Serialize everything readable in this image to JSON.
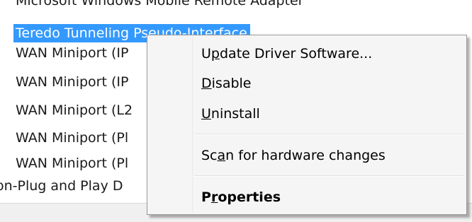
{
  "tree": {
    "rows": [
      {
        "label": "Microsoft Windows Mobile Remote Adapter"
      },
      {
        "label": "Teredo Tunneling Pseudo-Interface",
        "selected": true
      },
      {
        "label": "WAN Miniport (IP"
      },
      {
        "label": "WAN Miniport (IP"
      },
      {
        "label": "WAN Miniport (L2"
      },
      {
        "label": "WAN Miniport (Pl"
      },
      {
        "label": "WAN Miniport (Pl"
      },
      {
        "label": "on-Plug and Play D"
      }
    ]
  },
  "context_menu": {
    "items": [
      {
        "pre": "U",
        "mn": "p",
        "post": "date Driver Software..."
      },
      {
        "pre": "",
        "mn": "D",
        "post": "isable"
      },
      {
        "pre": "",
        "mn": "U",
        "post": "ninstall"
      },
      {
        "pre": "Sc",
        "mn": "a",
        "post": "n for hardware changes"
      },
      {
        "pre": "P",
        "mn": "r",
        "post": "operties"
      }
    ]
  },
  "colors": {
    "selection": "#3399ff",
    "menu_background": "#f5f5f5"
  }
}
